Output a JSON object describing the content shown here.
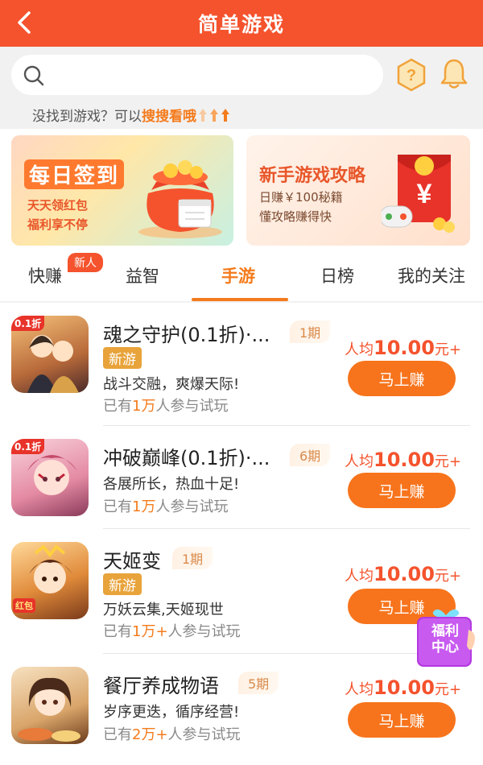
{
  "header": {
    "title": "简单游戏"
  },
  "search": {
    "placeholder": ""
  },
  "hint": {
    "prefix": "没找到游戏？可以",
    "link": "搜搜看哦"
  },
  "banners": [
    {
      "title": "每日签到",
      "lines": [
        "天天领红包",
        "福利享不停"
      ]
    },
    {
      "title": "新手游戏攻略",
      "lines": [
        "日赚￥100秘籍",
        "懂攻略赚得快"
      ]
    }
  ],
  "tabs": [
    {
      "label": "快赚",
      "badge": "新人"
    },
    {
      "label": "益智"
    },
    {
      "label": "手游",
      "active": true
    },
    {
      "label": "日榜"
    },
    {
      "label": "我的关注"
    }
  ],
  "games": [
    {
      "name": "魂之守护(0.1折)·...",
      "issue": "1期",
      "tag": "新游",
      "desc": "战斗交融，爽爆天际!",
      "players_prefix": "已有",
      "players_num": "1万",
      "players_suffix": "人参与试玩",
      "avg_prefix": "人均",
      "avg_value": "10.00",
      "avg_unit": "元+",
      "button": "马上赚",
      "icon_badge": "0.1折"
    },
    {
      "name": "冲破巅峰(0.1折)·...",
      "issue": "6期",
      "desc": "各展所长，热血十足!",
      "players_prefix": "已有",
      "players_num": "1万",
      "players_suffix": "人参与试玩",
      "avg_prefix": "人均",
      "avg_value": "10.00",
      "avg_unit": "元+",
      "button": "马上赚",
      "icon_badge": "0.1折"
    },
    {
      "name": "天姬变",
      "issue": "1期",
      "tag": "新游",
      "desc": "万妖云集,天姬现世",
      "players_prefix": "已有",
      "players_num": "1万+",
      "players_suffix": "人参与试玩",
      "avg_prefix": "人均",
      "avg_value": "10.00",
      "avg_unit": "元+",
      "button": "马上赚",
      "icon_badge": "红包"
    },
    {
      "name": "餐厅养成物语",
      "issue": "5期",
      "desc": "岁序更迭，循序经营!",
      "players_prefix": "已有",
      "players_num": "2万+",
      "players_suffix": "人参与试玩",
      "avg_prefix": "人均",
      "avg_value": "10.00",
      "avg_unit": "元+",
      "button": "马上赚"
    }
  ],
  "floating": {
    "line1": "福利",
    "line2": "中心"
  },
  "colors": {
    "brand": "#f4532d",
    "accent": "#f47b1c"
  }
}
